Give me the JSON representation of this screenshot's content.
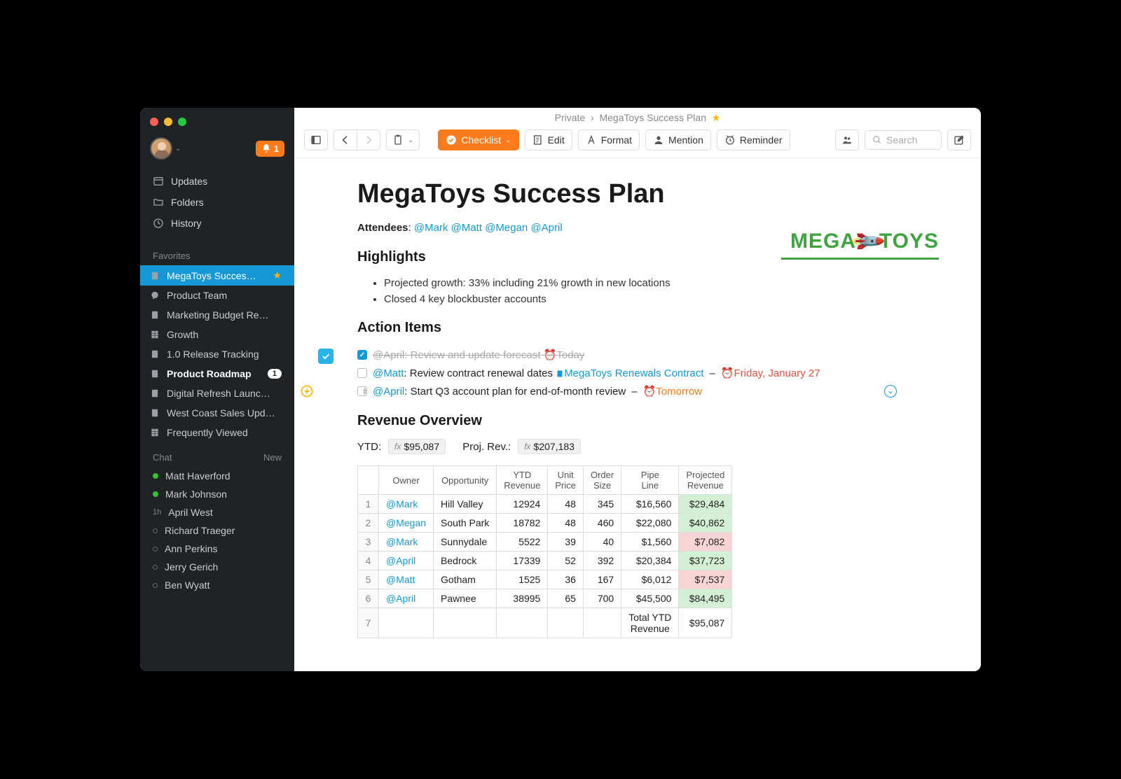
{
  "notifications": "1",
  "sidebar": {
    "nav": [
      {
        "icon": "updates",
        "label": "Updates"
      },
      {
        "icon": "folders",
        "label": "Folders"
      },
      {
        "icon": "history",
        "label": "History"
      }
    ],
    "favorites_title": "Favorites",
    "favorites": [
      {
        "label": "MegaToys Succes…",
        "active": true,
        "star": true
      },
      {
        "label": "Product Team",
        "icon": "chat"
      },
      {
        "label": "Marketing Budget Re…"
      },
      {
        "label": "Growth",
        "icon": "spread"
      },
      {
        "label": "1.0 Release Tracking"
      },
      {
        "label": "Product Roadmap",
        "bold": true,
        "badge": "1"
      },
      {
        "label": "Digital Refresh Launc…"
      },
      {
        "label": "West Coast Sales Upd…"
      },
      {
        "label": "Frequently Viewed",
        "icon": "spread"
      }
    ],
    "chat_title": "Chat",
    "chat_new": "New",
    "chats": [
      {
        "name": "Matt Haverford",
        "status": "online"
      },
      {
        "name": "Mark Johnson",
        "status": "online"
      },
      {
        "name": "April West",
        "status": "time",
        "time": "1h"
      },
      {
        "name": "Richard Traeger",
        "status": "offline"
      },
      {
        "name": "Ann Perkins",
        "status": "offline"
      },
      {
        "name": "Jerry Gerich",
        "status": "offline"
      },
      {
        "name": "Ben Wyatt",
        "status": "offline"
      }
    ]
  },
  "breadcrumb": {
    "parent": "Private",
    "title": "MegaToys Success Plan"
  },
  "toolbar": {
    "checklist": "Checklist",
    "edit": "Edit",
    "format": "Format",
    "mention": "Mention",
    "reminder": "Reminder",
    "search_ph": "Search"
  },
  "doc": {
    "title": "MegaToys Success Plan",
    "attendees_label": "Attendees",
    "attendees": [
      "@Mark",
      "@Matt",
      "@Megan",
      "@April"
    ],
    "highlights_title": "Highlights",
    "highlights": [
      "Projected growth: 33% including 21% growth in new locations",
      "Closed 4 key blockbuster accounts"
    ],
    "action_title": "Action Items",
    "actions": [
      {
        "done": true,
        "mention": "@April",
        "text": "Review and update forecast",
        "due": "Today",
        "due_class": "done"
      },
      {
        "done": false,
        "mention": "@Matt",
        "text": "Review contract renewal dates",
        "link": "MegaToys Renewals Contract",
        "due": "Friday, January 27",
        "due_class": "due"
      },
      {
        "done": false,
        "mention": "@April",
        "text": "Start Q3 account plan for end-of-month review",
        "due": "Tomorrow",
        "due_class": "soon"
      }
    ],
    "revenue_title": "Revenue Overview",
    "ytd_label": "YTD:",
    "ytd_value": "$95,087",
    "proj_label": "Proj. Rev.:",
    "proj_value": "$207,183",
    "logo": "MEGA🚀TOYS",
    "table": {
      "headers": [
        "",
        "Owner",
        "Opportunity",
        "YTD Revenue",
        "Unit Price",
        "Order Size",
        "Pipe Line",
        "Projected Revenue"
      ],
      "rows": [
        {
          "n": "1",
          "owner": "@Mark",
          "opp": "Hill Valley",
          "ytd": "12924",
          "unit": "48",
          "size": "345",
          "pipe": "$16,560",
          "proj": "$29,484",
          "cls": "pos"
        },
        {
          "n": "2",
          "owner": "@Megan",
          "opp": "South Park",
          "ytd": "18782",
          "unit": "48",
          "size": "460",
          "pipe": "$22,080",
          "proj": "$40,862",
          "cls": "pos"
        },
        {
          "n": "3",
          "owner": "@Mark",
          "opp": "Sunnydale",
          "ytd": "5522",
          "unit": "39",
          "size": "40",
          "pipe": "$1,560",
          "proj": "$7,082",
          "cls": "neg"
        },
        {
          "n": "4",
          "owner": "@April",
          "opp": "Bedrock",
          "ytd": "17339",
          "unit": "52",
          "size": "392",
          "pipe": "$20,384",
          "proj": "$37,723",
          "cls": "pos"
        },
        {
          "n": "5",
          "owner": "@Matt",
          "opp": "Gotham",
          "ytd": "1525",
          "unit": "36",
          "size": "167",
          "pipe": "$6,012",
          "proj": "$7,537",
          "cls": "neg"
        },
        {
          "n": "6",
          "owner": "@April",
          "opp": "Pawnee",
          "ytd": "38995",
          "unit": "65",
          "size": "700",
          "pipe": "$45,500",
          "proj": "$84,495",
          "cls": "pos"
        }
      ],
      "total_label": "Total YTD Revenue",
      "total_value": "$95,087",
      "total_n": "7"
    }
  }
}
